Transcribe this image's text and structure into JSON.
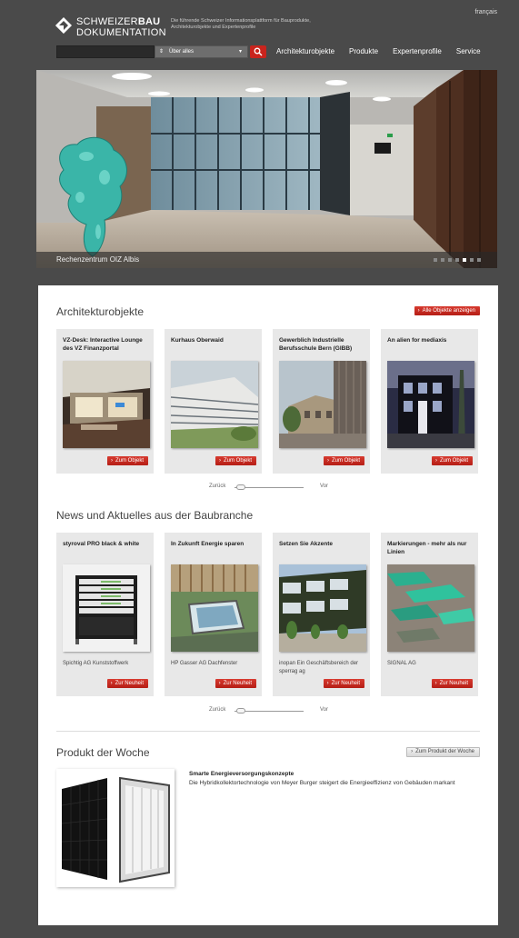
{
  "language_link": "français",
  "logo": {
    "line1_a": "SCHWEIZER",
    "line1_b": "BAU",
    "line2": "DOKUMENTATION"
  },
  "tagline": "Die führende Schweizer Informationsplattform für Bauprodukte, Architekturobjekte und Expertenprofile",
  "search": {
    "placeholder": "",
    "scope_selected": "Über alles"
  },
  "nav": [
    "Architekturobjekte",
    "Produkte",
    "Expertenprofile",
    "Service"
  ],
  "hero": {
    "caption": "Rechenzentrum OIZ Albis",
    "slide_count": 7,
    "active_slide": 5
  },
  "arch": {
    "title": "Architekturobjekte",
    "all_button": "Alle Objekte anzeigen",
    "cards": [
      {
        "title": "VZ-Desk: Interactive Lounge des VZ Finanzportal",
        "button": "Zum Objekt"
      },
      {
        "title": "Kurhaus Oberwaid",
        "button": "Zum Objekt"
      },
      {
        "title": "Gewerblich Industrielle Berufsschule Bern (GIBB)",
        "button": "Zum Objekt"
      },
      {
        "title": "An alien for mediaxis",
        "button": "Zum Objekt"
      }
    ],
    "slider": {
      "back": "Zurück",
      "forward": "Vor"
    }
  },
  "news": {
    "title": "News und Aktuelles aus der Baubranche",
    "cards": [
      {
        "title": "styroval PRO black & white",
        "source": "Spichtig AG Kunststoffwerk",
        "button": "Zur Neuheit"
      },
      {
        "title": "In Zukunft Energie sparen",
        "source": "HP Gasser AG Dachfenster",
        "button": "Zur Neuheit"
      },
      {
        "title": "Setzen Sie Akzente",
        "source": "inopan Ein Geschäftsbereich der sperrag ag",
        "button": "Zur Neuheit"
      },
      {
        "title": "Markierungen - mehr als nur Linien",
        "source": "SIGNAL AG",
        "button": "Zur Neuheit"
      }
    ],
    "slider": {
      "back": "Zurück",
      "forward": "Vor"
    }
  },
  "pdw": {
    "title": "Produkt der Woche",
    "button": "Zum Produkt der Woche",
    "product_title": "Smarte Energieversorgungskonzepte",
    "product_text": "Die Hybridkollektortechnologie von Meyer Burger steigert die Energieeffizienz von Gebäuden markant"
  },
  "colors": {
    "background": "#4a4a4a",
    "accent_red": "#c9241d",
    "card_bg": "#e8e8e8"
  }
}
